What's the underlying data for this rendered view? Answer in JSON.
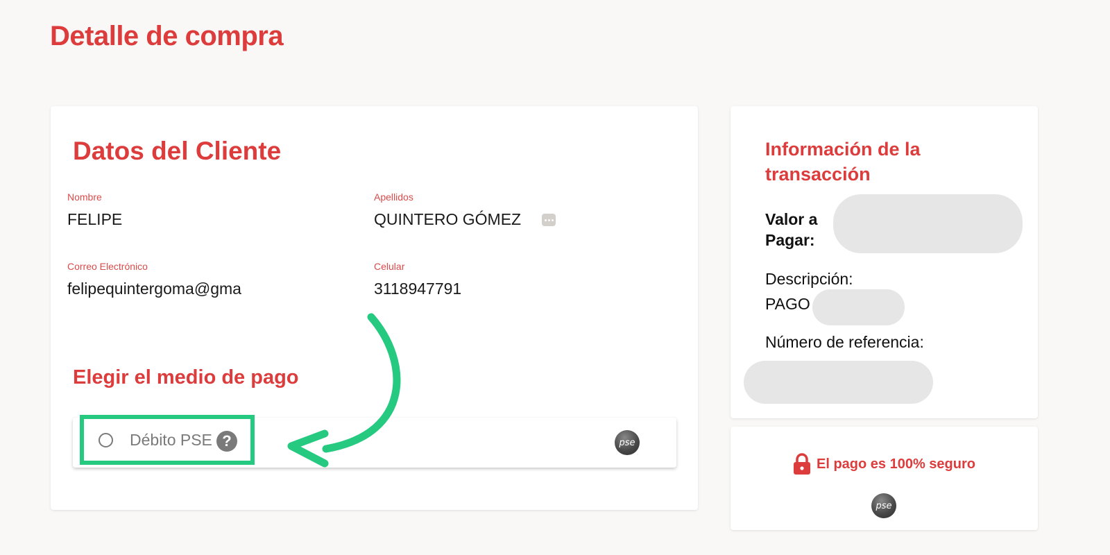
{
  "page": {
    "title": "Detalle de compra"
  },
  "client": {
    "section_title": "Datos del Cliente",
    "nombre_label": "Nombre",
    "nombre_value": "FELIPE",
    "apellidos_label": "Apellidos",
    "apellidos_value": "QUINTERO GÓMEZ",
    "email_label": "Correo Electrónico",
    "email_value": "felipequintergoma@gma",
    "celular_label": "Celular",
    "celular_value": "3118947791"
  },
  "payment": {
    "section_title": "Elegir el medio de pago",
    "method_label": "Débito PSE",
    "help_glyph": "?",
    "logo_text": "pse",
    "highlight_color": "#25c97f"
  },
  "transaction": {
    "title": "Información de la transacción",
    "valor_label": "Valor a Pagar:",
    "descripcion_label": "Descripción:",
    "descripcion_value": "PAGO",
    "referencia_label": "Número de referencia:"
  },
  "secure": {
    "text": "El pago es 100% seguro",
    "icon": "lock-icon",
    "logo_text": "pse"
  },
  "colors": {
    "accent": "#dc3c3c",
    "annotation": "#25c97f",
    "muted": "#7a7a7a"
  }
}
